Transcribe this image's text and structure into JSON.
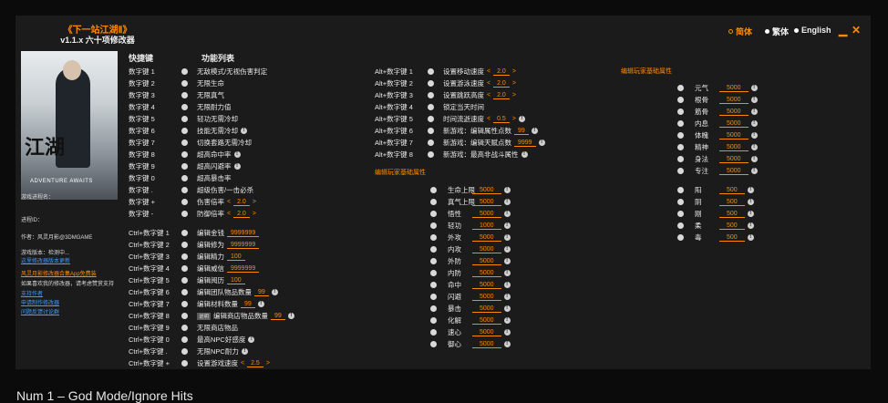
{
  "header": {
    "title": "《下一站江湖Ⅱ》",
    "subtitle": "v1.1.x 六十项修改器"
  },
  "languages": [
    {
      "label": "简体",
      "active": true
    },
    {
      "label": "繁体",
      "active": false
    },
    {
      "label": "English",
      "active": false
    }
  ],
  "sidebar": {
    "cover_title": "江湖",
    "cover_subtitle": "ADVENTURE AWAITS",
    "process_label": "游戏进程名：",
    "process_id_label": "进程ID：",
    "author": "作者：风灵月影@3DMGAME",
    "version_note": "游戏版本：检测中...",
    "version_link": "这里修改器版本更新",
    "app_link": "风灵月影修改器合集App免费装",
    "support_text": "如果喜欢我的修改器，请考虑赞赏支持",
    "links": [
      "支持作者",
      "申请制作修改器",
      "问题反馈讨论群"
    ]
  },
  "columns": {
    "hotkey": "快捷键",
    "feature": "功能列表"
  },
  "col1": [
    {
      "key": "数字键 1",
      "label": "无敌模式/无视伤害判定"
    },
    {
      "key": "数字键 2",
      "label": "无限生命"
    },
    {
      "key": "数字键 3",
      "label": "无限真气"
    },
    {
      "key": "数字键 4",
      "label": "无限耐力值"
    },
    {
      "key": "数字键 5",
      "label": "轻功无需冷却"
    },
    {
      "key": "数字键 6",
      "label": "技能无需冷却",
      "info": true
    },
    {
      "key": "数字键 7",
      "label": "切换套路无需冷却"
    },
    {
      "key": "数字键 8",
      "label": "超高命中率",
      "info": true
    },
    {
      "key": "数字键 9",
      "label": "超高闪避率",
      "info": true
    },
    {
      "key": "数字键 0",
      "label": "超高暴击率"
    },
    {
      "key": "数字键 .",
      "label": "超级伤害/一击必杀"
    },
    {
      "key": "数字键 +",
      "label": "伤害倍率",
      "value": "2.0",
      "arrows": true
    },
    {
      "key": "数字键 -",
      "label": "防御倍率",
      "value": "2.0",
      "arrows": true
    }
  ],
  "col2": [
    {
      "key": "Ctrl+数字键 1",
      "label": "编辑金钱",
      "value": "9999999"
    },
    {
      "key": "Ctrl+数字键 2",
      "label": "编辑修为",
      "value": "9999999"
    },
    {
      "key": "Ctrl+数字键 3",
      "label": "编辑精力",
      "value": "100"
    },
    {
      "key": "Ctrl+数字键 4",
      "label": "编辑威信",
      "value": "9999999"
    },
    {
      "key": "Ctrl+数字键 5",
      "label": "编辑阅历",
      "value": "100"
    },
    {
      "key": "Ctrl+数字键 6",
      "label": "编辑团队物品数量",
      "value": "99",
      "info": true
    },
    {
      "key": "Ctrl+数字键 7",
      "label": "编辑材料数量",
      "value": "99",
      "info": true
    },
    {
      "key": "Ctrl+数字键 8",
      "label": "编辑商店物品数量",
      "value": "99",
      "info": true,
      "button": "说明"
    },
    {
      "key": "Ctrl+数字键 9",
      "label": "无限商店物品"
    },
    {
      "key": "Ctrl+数字键 0",
      "label": "最高NPC好感度",
      "info": true
    },
    {
      "key": "Ctrl+数字键 .",
      "label": "无限NPC耐力",
      "info": true
    },
    {
      "key": "Ctrl+数字键 +",
      "label": "设置游戏速度",
      "value": "2.5",
      "arrows": true
    }
  ],
  "col3": [
    {
      "key": "Alt+数字键 1",
      "label": "设置移动速度",
      "value": "2.0",
      "arrows": true
    },
    {
      "key": "Alt+数字键 2",
      "label": "设置游泳速度",
      "value": "2.0",
      "arrows": true
    },
    {
      "key": "Alt+数字键 3",
      "label": "设置跳跃高度",
      "value": "2.0",
      "arrows": true
    },
    {
      "key": "Alt+数字键 4",
      "label": "锁定当天时间"
    },
    {
      "key": "Alt+数字键 5",
      "label": "时间流逝速度",
      "value": "0.5",
      "arrows": true,
      "info": true
    },
    {
      "key": "Alt+数字键 6",
      "label": "新游戏：编辑属性点数",
      "value": "99",
      "info": true
    },
    {
      "key": "Alt+数字键 7",
      "label": "新游戏：编辑天赋点数",
      "value": "9999",
      "info": true
    },
    {
      "key": "Alt+数字键 8",
      "label": "新游戏：最高非战斗属性",
      "info": true
    }
  ],
  "main_section": "编辑玩家基础属性",
  "main_stats": [
    {
      "label": "生命上限",
      "value": "5000"
    },
    {
      "label": "真气上限",
      "value": "5000"
    },
    {
      "label": "悟性",
      "value": "5000"
    },
    {
      "label": "轻功",
      "value": "1000"
    },
    {
      "label": "外攻",
      "value": "5000"
    },
    {
      "label": "内攻",
      "value": "5000"
    },
    {
      "label": "外防",
      "value": "5000"
    },
    {
      "label": "内防",
      "value": "5000"
    },
    {
      "label": "命中",
      "value": "5000"
    },
    {
      "label": "闪避",
      "value": "5000"
    },
    {
      "label": "暴击",
      "value": "5000"
    },
    {
      "label": "化解",
      "value": "5000"
    },
    {
      "label": "速心",
      "value": "5000"
    },
    {
      "label": "御心",
      "value": "5000"
    }
  ],
  "attr_section": "编辑玩家基础属性",
  "attr_stats": [
    {
      "label": "元气",
      "value": "5000"
    },
    {
      "label": "根骨",
      "value": "5000"
    },
    {
      "label": "筋骨",
      "value": "5000"
    },
    {
      "label": "内息",
      "value": "5000"
    },
    {
      "label": "体魄",
      "value": "5000"
    },
    {
      "label": "精神",
      "value": "5000"
    },
    {
      "label": "身法",
      "value": "5000"
    },
    {
      "label": "专注",
      "value": "5000"
    }
  ],
  "elem_stats": [
    {
      "label": "阳",
      "value": "500"
    },
    {
      "label": "阴",
      "value": "500"
    },
    {
      "label": "刚",
      "value": "500"
    },
    {
      "label": "柔",
      "value": "500"
    },
    {
      "label": "毒",
      "value": "500"
    }
  ],
  "footer": "Num 1 – God Mode/Ignore Hits"
}
